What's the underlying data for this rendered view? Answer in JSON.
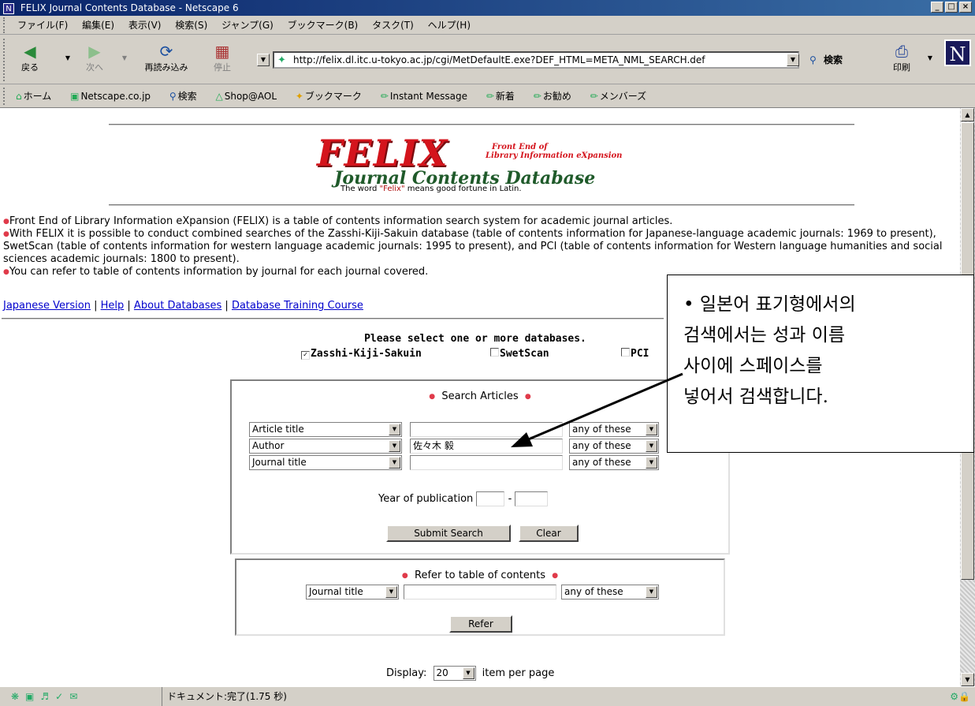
{
  "window": {
    "title": "FELIX  Journal Contents Database - Netscape 6",
    "app_icon": "N",
    "buttons": [
      "_",
      "□",
      "×"
    ]
  },
  "menu": [
    "ファイル(F)",
    "編集(E)",
    "表示(V)",
    "検索(S)",
    "ジャンプ(G)",
    "ブックマーク(B)",
    "タスク(T)",
    "ヘルプ(H)"
  ],
  "nav": {
    "back": "戻る",
    "forward": "次へ",
    "reload": "再読み込み",
    "stop": "停止",
    "url": "http://felix.dl.itc.u-tokyo.ac.jp/cgi/MetDefaultE.exe?DEF_HTML=META_NML_SEARCH.def",
    "search": "検索",
    "print": "印刷",
    "logo": "N"
  },
  "bookmarks": [
    "ホーム",
    "Netscape.co.jp",
    "検索",
    "Shop@AOL",
    "ブックマーク",
    "Instant Message",
    "新着",
    "お勧め",
    "メンバーズ"
  ],
  "logo": {
    "felix": "FELIX",
    "subtitle_1": "Front End of",
    "subtitle_2": "Library Information eXpansion",
    "name": "Journal Contents Database",
    "motto_pre": "The word",
    "motto_word": "\"Felix\"",
    "motto_post": "means good fortune in Latin."
  },
  "intro": [
    "Front End of Library Information eXpansion (FELIX) is a table of contents information search system for academic journal articles.",
    "With FELIX it is possible to conduct combined searches of the Zasshi-Kiji-Sakuin database (table of contents information for Japanese-language academic journals: 1969 to present), SwetScan (table of contents information for western language academic journals: 1995 to present), and PCI (table of contents information for Western language humanities and social sciences academic journals: 1800 to present).",
    "You can refer to table of contents information by journal for each journal covered."
  ],
  "links": [
    "Japanese Version",
    "Help",
    "About Databases",
    "Database Training Course"
  ],
  "databases": {
    "prompt": "Please select one or more databases.",
    "items": [
      {
        "label": "Zasshi-Kiji-Sakuin",
        "checked": true
      },
      {
        "label": "SwetScan",
        "checked": false
      },
      {
        "label": "PCI",
        "checked": false
      }
    ]
  },
  "search": {
    "title": "Search Articles",
    "rows": [
      {
        "field": "Article title",
        "value": "",
        "match": "any of these"
      },
      {
        "field": "Author",
        "value": "佐々木 毅",
        "match": "any of these"
      },
      {
        "field": "Journal title",
        "value": "",
        "match": "any of these"
      }
    ],
    "year_label": "Year of publication",
    "year_sep": "-",
    "submit": "Submit Search",
    "clear": "Clear"
  },
  "refer": {
    "title": "Refer to table of contents",
    "field": "Journal title",
    "match": "any of these",
    "button": "Refer"
  },
  "display": {
    "label": "Display:",
    "value": "20",
    "suffix": "item per page"
  },
  "status": "ドキュメント:完了(1.75 秒)",
  "callout": {
    "line1": "• 일본어 표기형에서의",
    "line2": "검색에서는 성과 이름",
    "line3": "사이에 스페이스를",
    "line4": "넣어서 검색합니다."
  },
  "colors": {
    "felix_red": "#d4141c",
    "title_green": "#1f5a2a",
    "link_blue": "#0000cc",
    "bullet_red": "#e03a4a"
  }
}
